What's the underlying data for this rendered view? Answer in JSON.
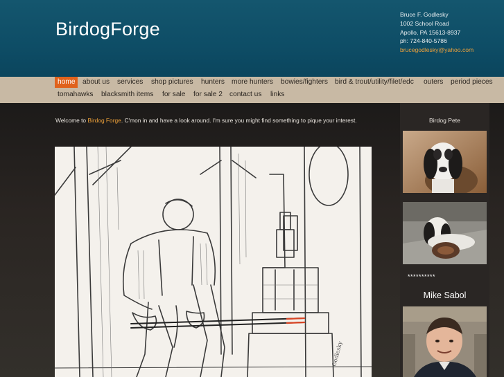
{
  "site": {
    "title": "BirdogForge"
  },
  "contact": {
    "name": "Bruce F. Godlesky",
    "street": "1002 School Road",
    "city": "Apollo, PA 15613-8937",
    "phone": "ph: 724-840-5786",
    "email": "brucegodlesky@yahoo.com"
  },
  "nav": {
    "items": [
      {
        "label": "home",
        "active": true
      },
      {
        "label": "about us"
      },
      {
        "label": "services"
      },
      {
        "label": "shop pictures"
      },
      {
        "label": "hunters"
      },
      {
        "label": "more hunters"
      },
      {
        "label": "bowies/fighters"
      },
      {
        "label": "bird & trout/utility/filet/edc"
      },
      {
        "label": "outers"
      },
      {
        "label": "period pieces"
      },
      {
        "label": "tomahawks"
      },
      {
        "label": "blacksmith items"
      },
      {
        "label": "for sale"
      },
      {
        "label": "for sale 2"
      },
      {
        "label": "contact us"
      },
      {
        "label": "links"
      }
    ]
  },
  "main": {
    "welcome_prefix": "Welcome to ",
    "welcome_link": "Birdog Forge",
    "welcome_suffix": ". C'mon in and have a look around. I'm sure you might find something to pique your interest."
  },
  "sidebar": {
    "title": "Birdog Pete",
    "stars": "**********",
    "person": "Mike Sabol"
  },
  "colors": {
    "header_bg": "#0e4d66",
    "nav_bg": "#c8b9a4",
    "active_nav": "#e0621c",
    "link": "#f0a23a"
  }
}
